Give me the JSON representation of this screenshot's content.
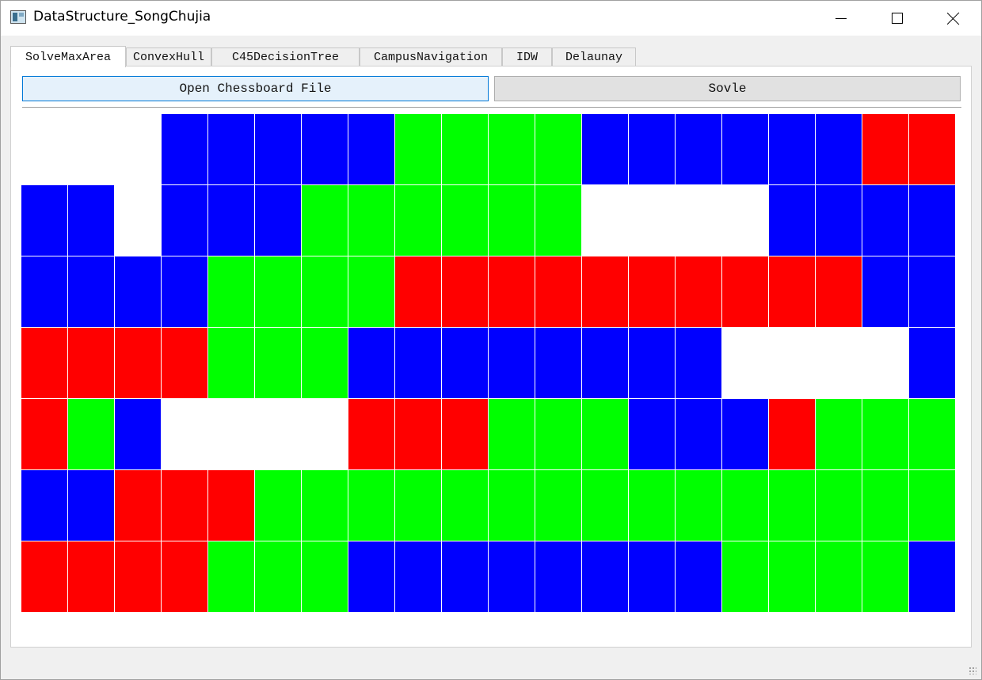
{
  "window": {
    "title": "DataStructure_SongChujia",
    "app_icon": "app-window-icon",
    "controls": {
      "minimize": "minimize-icon",
      "maximize": "maximize-icon",
      "close": "close-icon"
    }
  },
  "tabs": [
    {
      "label": "SolveMaxArea",
      "active": true
    },
    {
      "label": "ConvexHull",
      "active": false
    },
    {
      "label": "C45DecisionTree",
      "active": false
    },
    {
      "label": "CampusNavigation",
      "active": false
    },
    {
      "label": "IDW",
      "active": false
    },
    {
      "label": "Delaunay",
      "active": false
    }
  ],
  "toolbar": {
    "open_label": "Open Chessboard File",
    "solve_label": "Sovle"
  },
  "colors": {
    "R": "#ff0000",
    "G": "#00ff00",
    "B": "#0000ff",
    "W": "#ffffff",
    "open_button_bg": "#e5f1fb",
    "open_button_border": "#0078d7"
  },
  "chessboard": {
    "rows": 7,
    "cols": 20,
    "grid": [
      [
        "W",
        "W",
        "W",
        "B",
        "B",
        "B",
        "B",
        "B",
        "G",
        "G",
        "G",
        "G",
        "B",
        "B",
        "B",
        "B",
        "B",
        "B",
        "R",
        "R"
      ],
      [
        "B",
        "B",
        "W",
        "B",
        "B",
        "B",
        "G",
        "G",
        "G",
        "G",
        "G",
        "G",
        "W",
        "W",
        "W",
        "W",
        "B",
        "B",
        "B",
        "B"
      ],
      [
        "B",
        "B",
        "B",
        "B",
        "G",
        "G",
        "G",
        "G",
        "R",
        "R",
        "R",
        "R",
        "R",
        "R",
        "R",
        "R",
        "R",
        "R",
        "B",
        "B"
      ],
      [
        "R",
        "R",
        "R",
        "R",
        "G",
        "G",
        "G",
        "B",
        "B",
        "B",
        "B",
        "B",
        "B",
        "B",
        "B",
        "W",
        "W",
        "W",
        "W",
        "B"
      ],
      [
        "R",
        "G",
        "B",
        "W",
        "W",
        "W",
        "W",
        "R",
        "R",
        "R",
        "G",
        "G",
        "G",
        "B",
        "B",
        "B",
        "R",
        "G",
        "G",
        "G"
      ],
      [
        "B",
        "B",
        "R",
        "R",
        "R",
        "G",
        "G",
        "G",
        "G",
        "G",
        "G",
        "G",
        "G",
        "G",
        "G",
        "G",
        "G",
        "G",
        "G",
        "G"
      ],
      [
        "R",
        "R",
        "R",
        "R",
        "G",
        "G",
        "G",
        "B",
        "B",
        "B",
        "B",
        "B",
        "B",
        "B",
        "B",
        "G",
        "G",
        "G",
        "G",
        "B"
      ]
    ]
  }
}
